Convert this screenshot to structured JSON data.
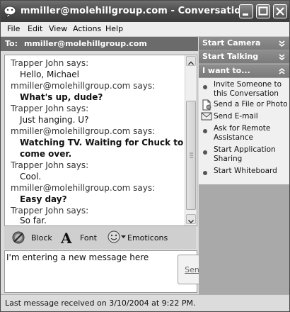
{
  "window": {
    "title": "mmiller@molehillgroup.com - Conversation"
  },
  "menu": [
    "File",
    "Edit",
    "View",
    "Actions",
    "Help"
  ],
  "to_bar": {
    "label": "To:",
    "address": "mmiller@molehillgroup.com"
  },
  "conversation": [
    {
      "sender": "Trapper John says:",
      "text": "Hello, Michael",
      "bold": false
    },
    {
      "sender": "mmiller@molehillgroup.com says:",
      "text": "What's up, dude?",
      "bold": true
    },
    {
      "sender": "Trapper John says:",
      "text": "Just hanging. U?",
      "bold": false
    },
    {
      "sender": "mmiller@molehillgroup.com says:",
      "text": "Watching TV. Waiting for Chuck to",
      "text2": "come over.",
      "bold": true
    },
    {
      "sender": "Trapper John says:",
      "text": "Cool.",
      "bold": false
    },
    {
      "sender": "mmiller@molehillgroup.com says:",
      "text": "Easy day?",
      "bold": true
    },
    {
      "sender": "Trapper John says:",
      "text": "So far.",
      "bold": false
    }
  ],
  "toolbar": {
    "block_label": "Block",
    "font_label": "Font",
    "emoticons_label": "Emoticons"
  },
  "compose": {
    "value": "I'm entering a new message here",
    "send_label": "Send"
  },
  "right_pane": {
    "start_camera": "Start Camera",
    "start_talking": "Start Talking",
    "i_want_to": "I want to...",
    "actions": [
      {
        "line1": "Invite Someone to",
        "line2": "this Conversation",
        "icon": "bullet"
      },
      {
        "line1": "Send a File or Photo",
        "line2": "",
        "icon": "file-icon"
      },
      {
        "line1": "Send E-mail",
        "line2": "",
        "icon": "envelope-icon"
      },
      {
        "line1": "Ask for Remote",
        "line2": "Assistance",
        "icon": "bullet"
      },
      {
        "line1": "Start Application",
        "line2": "Sharing",
        "icon": "bullet"
      },
      {
        "line1": "Start Whiteboard",
        "line2": "",
        "icon": "bullet"
      }
    ]
  },
  "status": {
    "text": "Last message received on 3/10/2004 at 9:22 PM."
  }
}
